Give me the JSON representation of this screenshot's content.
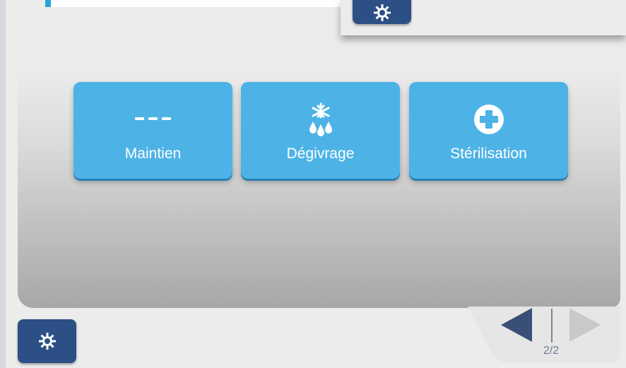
{
  "modes": {
    "maintien": {
      "label": "Maintien",
      "icon": "dashes-icon"
    },
    "degivrage": {
      "label": "Dégivrage",
      "icon": "snowflake-drops-icon"
    },
    "sterilisation": {
      "label": "Stérilisation",
      "icon": "plus-circle-icon"
    }
  },
  "pagination": {
    "indicator": "2/2"
  },
  "colors": {
    "mode_button": "#4db3e6",
    "settings_button": "#2c4f85",
    "nav_arrow_active": "#3a4f78",
    "nav_arrow_inactive": "#c9c9c9",
    "accent": "#29a4d8"
  },
  "icons": {
    "settings_top": "gear-icon",
    "settings_bottom": "gear-icon",
    "prev": "triangle-left-icon",
    "next": "triangle-right-icon"
  }
}
